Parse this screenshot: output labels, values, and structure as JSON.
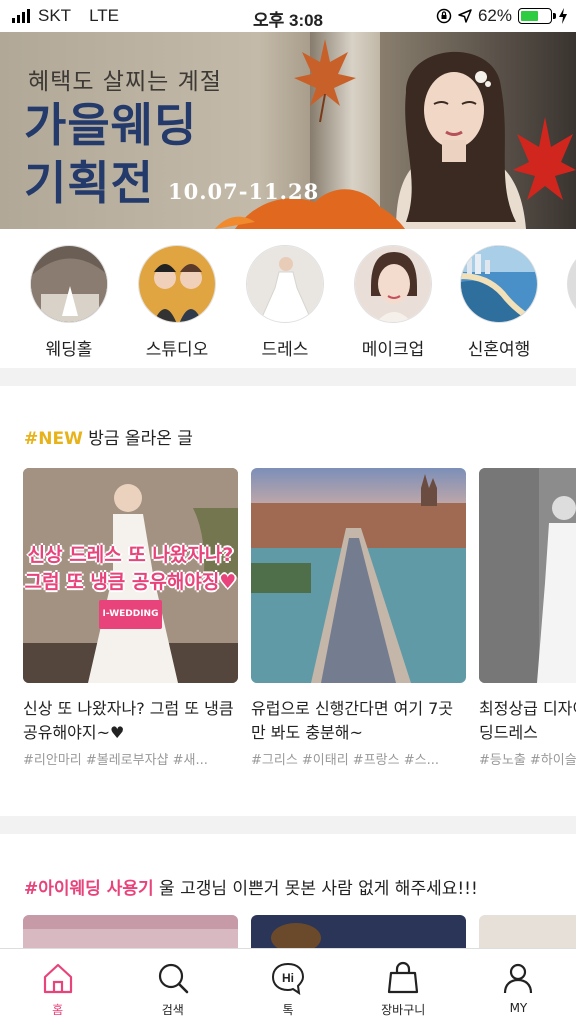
{
  "status_bar": {
    "carrier": "SKT",
    "network": "LTE",
    "time": "오후 3:08",
    "battery_text": "62%",
    "battery_level": 0.62
  },
  "banner": {
    "subtitle": "혜택도 살찌는 계절",
    "title_line1": "가을웨딩",
    "title_line2": "기획전",
    "date_range": "10.07-11.28"
  },
  "categories": [
    {
      "label": "웨딩홀"
    },
    {
      "label": "스튜디오"
    },
    {
      "label": "드레스"
    },
    {
      "label": "메이크업"
    },
    {
      "label": "신혼여행"
    }
  ],
  "new_section": {
    "tag": "#NEW",
    "heading": " 방금 올라온 글",
    "cards": [
      {
        "overlay_line1": "신상 드레스 또 나왔자나?",
        "overlay_line2": "그럼 또 냉큼 공유해야징♥",
        "overlay_badge": "I-WEDDING",
        "title": "신상 또 나왔자나? 그럼 또 냉큼 공유해야지~♥",
        "tags": "#리안마리 #볼레로부자샵 #새..."
      },
      {
        "title": "유럽으로 신행간다면 여기 7곳만 봐도 충분해~",
        "tags": "#그리스 #이태리 #프랑스 #스..."
      },
      {
        "title": "최정상급 디자이너가 제안한 웨딩드레스",
        "tags": "#등노출 #하이슬릿"
      }
    ]
  },
  "review_section": {
    "tag": "#아이웨딩 사용기",
    "heading": " 울 고갱님 이쁜거 못본 사람 없게 해주세요!!!"
  },
  "tab_bar": [
    {
      "label": "홈",
      "icon": "home-icon",
      "active": true
    },
    {
      "label": "검색",
      "icon": "search-icon"
    },
    {
      "label": "톡",
      "icon": "chat-hi-icon"
    },
    {
      "label": "장바구니",
      "icon": "shopping-bag-icon"
    },
    {
      "label": "MY",
      "icon": "user-icon"
    }
  ],
  "colors": {
    "accent": "#e8437a",
    "new_tag": "#e8b21a",
    "banner_title": "#233a6b"
  }
}
